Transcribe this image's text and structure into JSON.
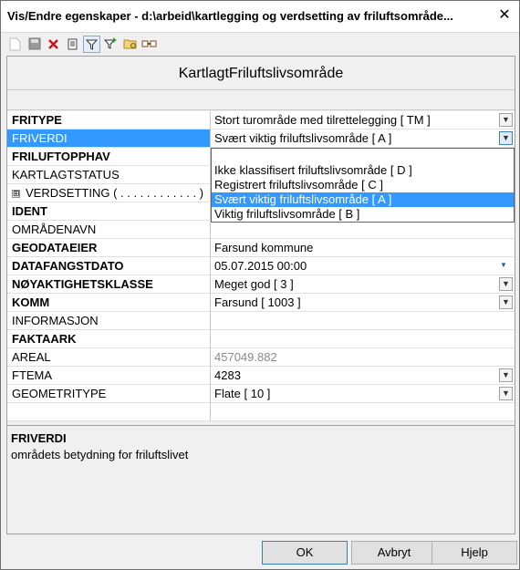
{
  "window": {
    "title": "Vis/Endre egenskaper - d:\\arbeid\\kartlegging og verdsetting av friluftsområde...",
    "close_glyph": "✕"
  },
  "toolbar": {
    "icons": [
      "new-document-icon",
      "save-icon",
      "delete-icon",
      "properties-icon",
      "filter-icon",
      "filter-add-icon",
      "folder-settings-icon",
      "link-icon"
    ]
  },
  "header": {
    "title": "KartlagtFriluftslivsområde"
  },
  "rows": [
    {
      "name": "FRITYPE",
      "value": "Stort turområde med tilrettelegging [ TM ]",
      "bold": true,
      "dropdown": true
    },
    {
      "name": "FRIVERDI",
      "value": "Svært viktig friluftslivsområde [ A ]",
      "bold": false,
      "selected": true,
      "dropdown": true
    },
    {
      "name": "FRILUFTOPPHAV",
      "value": "",
      "bold": true
    },
    {
      "name": "KARTLAGTSTATUS",
      "value": "",
      "bold": false
    },
    {
      "name": "VERDSETTING ( . . . . . . . . . . . . )",
      "value": "",
      "bold": false,
      "expander": "⊞"
    },
    {
      "name": "IDENT",
      "value": "",
      "bold": true
    },
    {
      "name": "OMRÅDENAVN",
      "value": "",
      "bold": false
    },
    {
      "name": "GEODATAEIER",
      "value": "Farsund kommune",
      "bold": true
    },
    {
      "name": "DATAFANGSTDATO",
      "value": "05.07.2015 00:00",
      "bold": true,
      "datepicker": true
    },
    {
      "name": "NØYAKTIGHETSKLASSE",
      "value": "Meget god [ 3 ]",
      "bold": true,
      "dropdown": true
    },
    {
      "name": "KOMM",
      "value": "Farsund [ 1003 ]",
      "bold": true,
      "dropdown": true
    },
    {
      "name": "INFORMASJON",
      "value": "",
      "bold": false
    },
    {
      "name": "FAKTAARK",
      "value": "",
      "bold": true
    },
    {
      "name": "AREAL",
      "value": "457049.882",
      "bold": false,
      "gray": true
    },
    {
      "name": "FTEMA",
      "value": "4283",
      "bold": false,
      "dropdown": true
    },
    {
      "name": "GEOMETRITYPE",
      "value": "Flate [ 10 ]",
      "bold": false,
      "dropdown": true
    }
  ],
  "dropdown": {
    "options": [
      "",
      "Ikke klassifisert friluftslivsområde [ D ]",
      "Registrert friluftslivsområde [ C ]",
      "Svært viktig friluftslivsområde [ A ]",
      "Viktig friluftslivsområde [ B ]"
    ],
    "highlighted_index": 3
  },
  "description": {
    "title": "FRIVERDI",
    "text": "områdets betydning for friluftslivet"
  },
  "buttons": {
    "ok": "OK",
    "cancel": "Avbryt",
    "help": "Hjelp"
  },
  "colors": {
    "selection": "#3399ff",
    "readonly_text": "#8a8a8a"
  }
}
